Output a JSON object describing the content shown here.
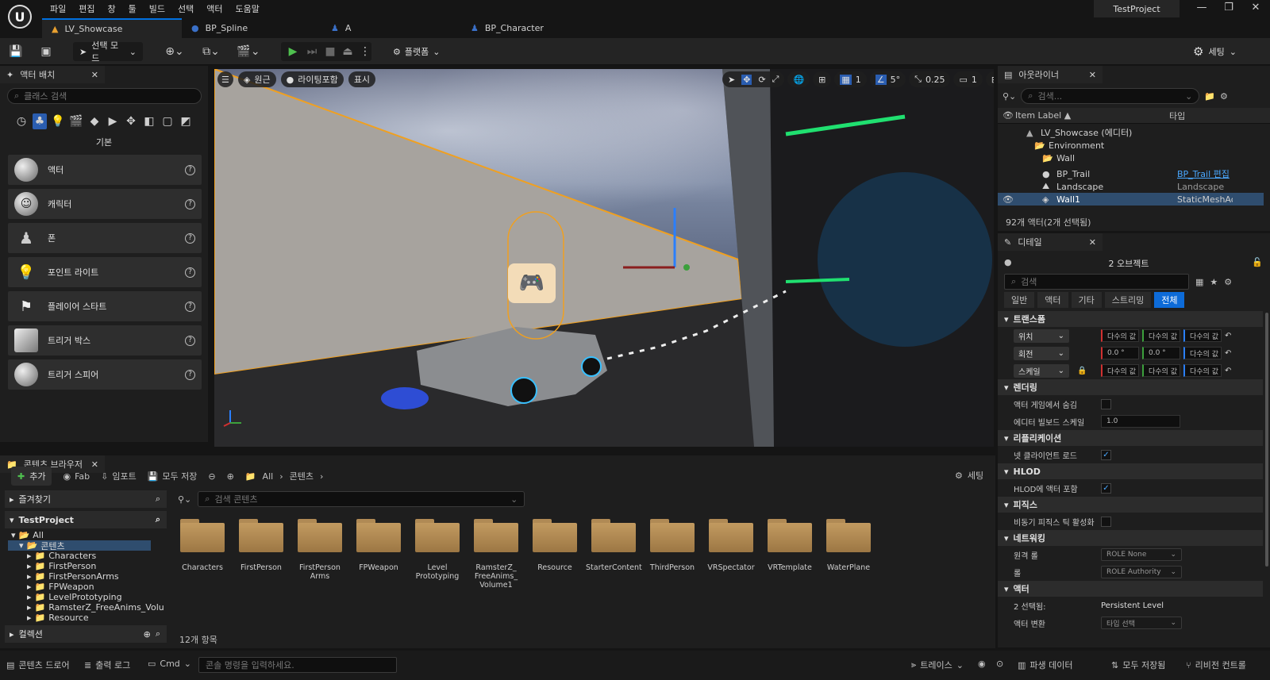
{
  "titlebar": {
    "logo": "U",
    "menus": [
      "파일",
      "편집",
      "창",
      "툴",
      "빌드",
      "선택",
      "액터",
      "도움말"
    ],
    "project": "TestProject",
    "tabs": [
      {
        "label": "LV_Showcase",
        "icon": "level-icon"
      },
      {
        "label": "BP_Spline",
        "icon": "blueprint-icon"
      },
      {
        "label": "A",
        "icon": "character-icon"
      },
      {
        "label": "BP_Character",
        "icon": "blueprint-icon"
      }
    ]
  },
  "toolbar": {
    "mode": "선택 모드",
    "platform": "플랫폼",
    "settings": "세팅"
  },
  "place_actors": {
    "tab": "액터 배치",
    "search_placeholder": "클래스 검색",
    "category": "기본",
    "items": [
      "액터",
      "캐릭터",
      "폰",
      "포인트 라이트",
      "플레이어 스타트",
      "트리거 박스",
      "트리거 스피어"
    ]
  },
  "viewport": {
    "perspective": "원근",
    "lighting": "라이팅포함",
    "show": "표시",
    "grid": "1",
    "angle": "5°",
    "scale": "0.25",
    "camera": "1"
  },
  "outliner": {
    "tab": "아웃라이너",
    "search_placeholder": "검색...",
    "col_label": "Item Label ▲",
    "col_type": "타입",
    "rows": [
      {
        "label": "LV_Showcase (에디터)",
        "type": ""
      },
      {
        "label": "Environment",
        "type": ""
      },
      {
        "label": "Wall",
        "type": ""
      },
      {
        "label": "BP_Trail",
        "type": "BP_Trail 편집"
      },
      {
        "label": "Landscape",
        "type": "Landscape"
      },
      {
        "label": "Wall1",
        "type": "StaticMeshActo"
      }
    ],
    "count": "92개 액터(2개 선택됨)"
  },
  "details": {
    "tab": "디테일",
    "objects": "2 오브젝트",
    "search_placeholder": "검색",
    "filters": [
      "일반",
      "액터",
      "기타",
      "스트리밍",
      "전체"
    ],
    "sections": {
      "transform": "트랜스폼",
      "rendering": "렌더링",
      "replication": "리플리케이션",
      "hlod": "HLOD",
      "physics": "피직스",
      "networking": "네트워킹",
      "actor": "액터"
    },
    "location": "위치",
    "rotation": "회전",
    "scale": "스케일",
    "multi": "다수의 값",
    "rot_x": "0.0 °",
    "rot_y": "0.0 °",
    "hide_in_game": "액터 게임에서 숨김",
    "billboard": "에디터 빌보드 스케일",
    "billboard_val": "1.0",
    "net_load": "넷 클라이언트 로드",
    "hlod_include": "HLOD에 액터 포함",
    "async_tick": "비동기 피직스 틱 활성화",
    "remote_role": "원격 롤",
    "remote_role_val": "ROLE None",
    "role": "롤",
    "role_val": "ROLE Authority",
    "selected": "2 선택됨:",
    "selected_val": "Persistent Level",
    "convert": "액터 변환",
    "convert_val": "타입 선택"
  },
  "content_browser": {
    "tab": "콘텐츠 브라우저",
    "add": "추가",
    "fab": "Fab",
    "import": "임포트",
    "save_all": "모두 저장",
    "path": [
      "All",
      "콘텐츠"
    ],
    "settings": "세팅",
    "favorites": "즐겨찾기",
    "project": "TestProject",
    "tree": [
      "All",
      "콘텐츠",
      "Characters",
      "FirstPerson",
      "FirstPersonArms",
      "FPWeapon",
      "LevelPrototyping",
      "RamsterZ_FreeAnims_Volume",
      "Resource"
    ],
    "collections": "컬렉션",
    "search_placeholder": "검색 콘텐츠",
    "folders": [
      "Characters",
      "FirstPerson",
      "FirstPerson\nArms",
      "FPWeapon",
      "Level\nPrototyping",
      "RamsterZ_\nFreeAnims_\nVolume1",
      "Resource",
      "StarterContent",
      "ThirdPerson",
      "VRSpectator",
      "VRTemplate",
      "WaterPlane"
    ],
    "count": "12개 항목"
  },
  "statusbar": {
    "drawer": "콘텐츠 드로어",
    "log": "출력 로그",
    "cmd": "Cmd",
    "cmd_placeholder": "콘솔 명령을 입력하세요.",
    "trace": "트레이스",
    "derived": "파생 데이터",
    "save_all": "모두 저장됨",
    "revision": "리비전 컨트롤"
  }
}
